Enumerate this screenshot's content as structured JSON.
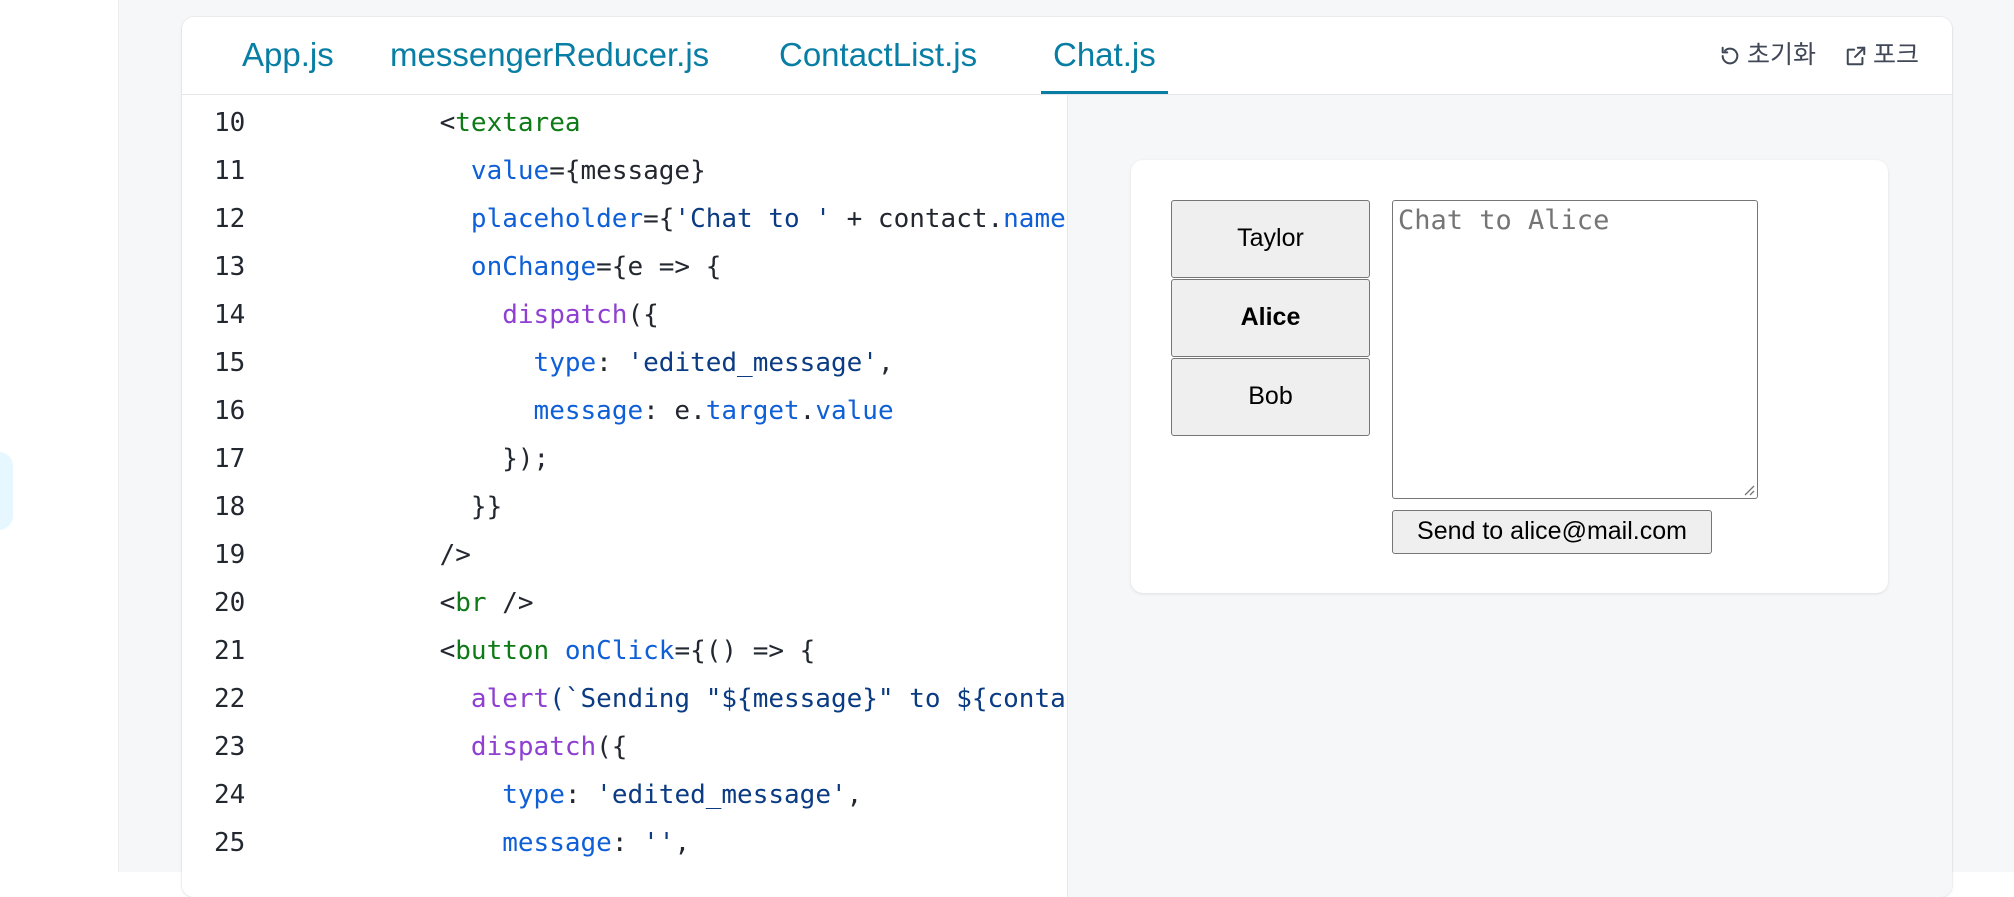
{
  "tabs": [
    {
      "label": "App.js",
      "active": false
    },
    {
      "label": "messengerReducer.js",
      "active": false
    },
    {
      "label": "ContactList.js",
      "active": false
    },
    {
      "label": "Chat.js",
      "active": true
    }
  ],
  "toolbar": {
    "reset_label": "초기화",
    "reset_icon": "reset-icon",
    "fork_label": "포크",
    "fork_icon": "external-link-icon"
  },
  "code_lines": [
    {
      "n": "10",
      "tokens": [
        [
          "p",
          "    <"
        ],
        [
          "tag",
          "textarea"
        ]
      ]
    },
    {
      "n": "11",
      "tokens": [
        [
          "p",
          "      "
        ],
        [
          "attr",
          "value"
        ],
        [
          "p",
          "={message}"
        ]
      ]
    },
    {
      "n": "12",
      "tokens": [
        [
          "p",
          "      "
        ],
        [
          "attr",
          "placeholder"
        ],
        [
          "p",
          "={"
        ],
        [
          "str",
          "'Chat to '"
        ],
        [
          "p",
          " + contact."
        ],
        [
          "attr",
          "name"
        ],
        [
          "p",
          "}"
        ]
      ]
    },
    {
      "n": "13",
      "tokens": [
        [
          "p",
          "      "
        ],
        [
          "attr",
          "onChange"
        ],
        [
          "p",
          "={e => {"
        ]
      ]
    },
    {
      "n": "14",
      "tokens": [
        [
          "p",
          "        "
        ],
        [
          "fn",
          "dispatch"
        ],
        [
          "p",
          "({"
        ]
      ]
    },
    {
      "n": "15",
      "tokens": [
        [
          "p",
          "          "
        ],
        [
          "attr",
          "type"
        ],
        [
          "p",
          ": "
        ],
        [
          "str",
          "'edited_message'"
        ],
        [
          "p",
          ","
        ]
      ]
    },
    {
      "n": "16",
      "tokens": [
        [
          "p",
          "          "
        ],
        [
          "attr",
          "message"
        ],
        [
          "p",
          ": e."
        ],
        [
          "attr",
          "target"
        ],
        [
          "p",
          "."
        ],
        [
          "attr",
          "value"
        ]
      ]
    },
    {
      "n": "17",
      "tokens": [
        [
          "p",
          "        });"
        ]
      ]
    },
    {
      "n": "18",
      "tokens": [
        [
          "p",
          "      }}"
        ]
      ]
    },
    {
      "n": "19",
      "tokens": [
        [
          "p",
          "    />"
        ]
      ]
    },
    {
      "n": "20",
      "tokens": [
        [
          "p",
          "    <"
        ],
        [
          "tag",
          "br"
        ],
        [
          "p",
          " />"
        ]
      ]
    },
    {
      "n": "21",
      "tokens": [
        [
          "p",
          "    <"
        ],
        [
          "tag",
          "button"
        ],
        [
          "p",
          " "
        ],
        [
          "attr",
          "onClick"
        ],
        [
          "p",
          "={() => {"
        ]
      ]
    },
    {
      "n": "22",
      "tokens": [
        [
          "p",
          "      "
        ],
        [
          "fn",
          "alert"
        ],
        [
          "str",
          "(`Sending \"${message}\" to ${contact"
        ]
      ]
    },
    {
      "n": "23",
      "tokens": [
        [
          "p",
          "      "
        ],
        [
          "fn",
          "dispatch"
        ],
        [
          "p",
          "({"
        ]
      ]
    },
    {
      "n": "24",
      "tokens": [
        [
          "p",
          "        "
        ],
        [
          "attr",
          "type"
        ],
        [
          "p",
          ": "
        ],
        [
          "str",
          "'edited_message'"
        ],
        [
          "p",
          ","
        ]
      ]
    },
    {
      "n": "25",
      "tokens": [
        [
          "p",
          "        "
        ],
        [
          "attr",
          "message"
        ],
        [
          "p",
          ": "
        ],
        [
          "str",
          "''"
        ],
        [
          "p",
          ","
        ]
      ]
    }
  ],
  "preview": {
    "contacts": [
      {
        "label": "Taylor",
        "selected": false
      },
      {
        "label": "Alice",
        "selected": true
      },
      {
        "label": "Bob",
        "selected": false
      }
    ],
    "textarea_value": "",
    "textarea_placeholder": "Chat to Alice",
    "send_label": "Send to alice@mail.com"
  },
  "colors": {
    "accent": "#087ea4",
    "jsx_tag": "#0e7b16",
    "jsx_attr": "#0f5fd7",
    "function": "#8f3fd1",
    "string": "#0b3b82"
  }
}
